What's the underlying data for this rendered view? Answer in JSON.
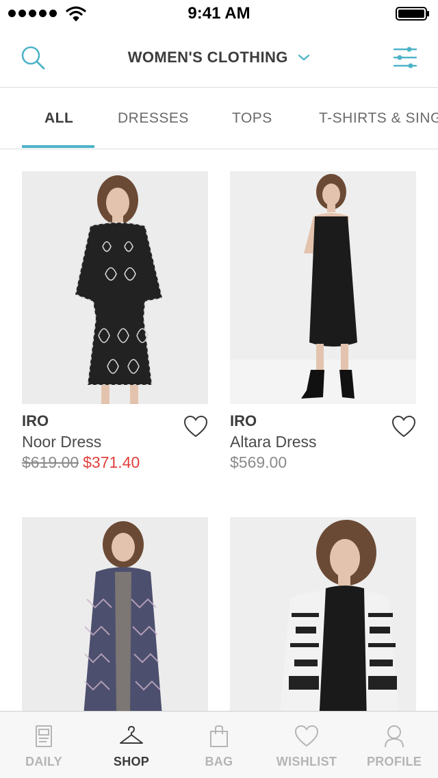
{
  "status_bar": {
    "time": "9:41 AM"
  },
  "header": {
    "title": "WOMEN'S CLOTHING"
  },
  "tabs": [
    {
      "label": "ALL",
      "active": true
    },
    {
      "label": "DRESSES"
    },
    {
      "label": "TOPS"
    },
    {
      "label": "T-SHIRTS & SINGLETS"
    }
  ],
  "products": [
    {
      "brand": "IRO",
      "name": "Noor Dress",
      "price_old": "$619.00",
      "price_sale": "$371.40"
    },
    {
      "brand": "IRO",
      "name": "Altara Dress",
      "price": "$569.00"
    },
    {
      "brand": "",
      "name": ""
    },
    {
      "brand": "",
      "name": ""
    }
  ],
  "bottom_nav": [
    {
      "label": "DAILY",
      "icon": "daily-icon"
    },
    {
      "label": "SHOP",
      "icon": "hanger-icon",
      "active": true
    },
    {
      "label": "BAG",
      "icon": "bag-icon"
    },
    {
      "label": "WISHLIST",
      "icon": "heart-icon"
    },
    {
      "label": "PROFILE",
      "icon": "profile-icon"
    }
  ],
  "colors": {
    "accent": "#4db3c8",
    "sale": "#e0403c",
    "text": "#3a3a3a",
    "muted": "#8a8a8a"
  }
}
